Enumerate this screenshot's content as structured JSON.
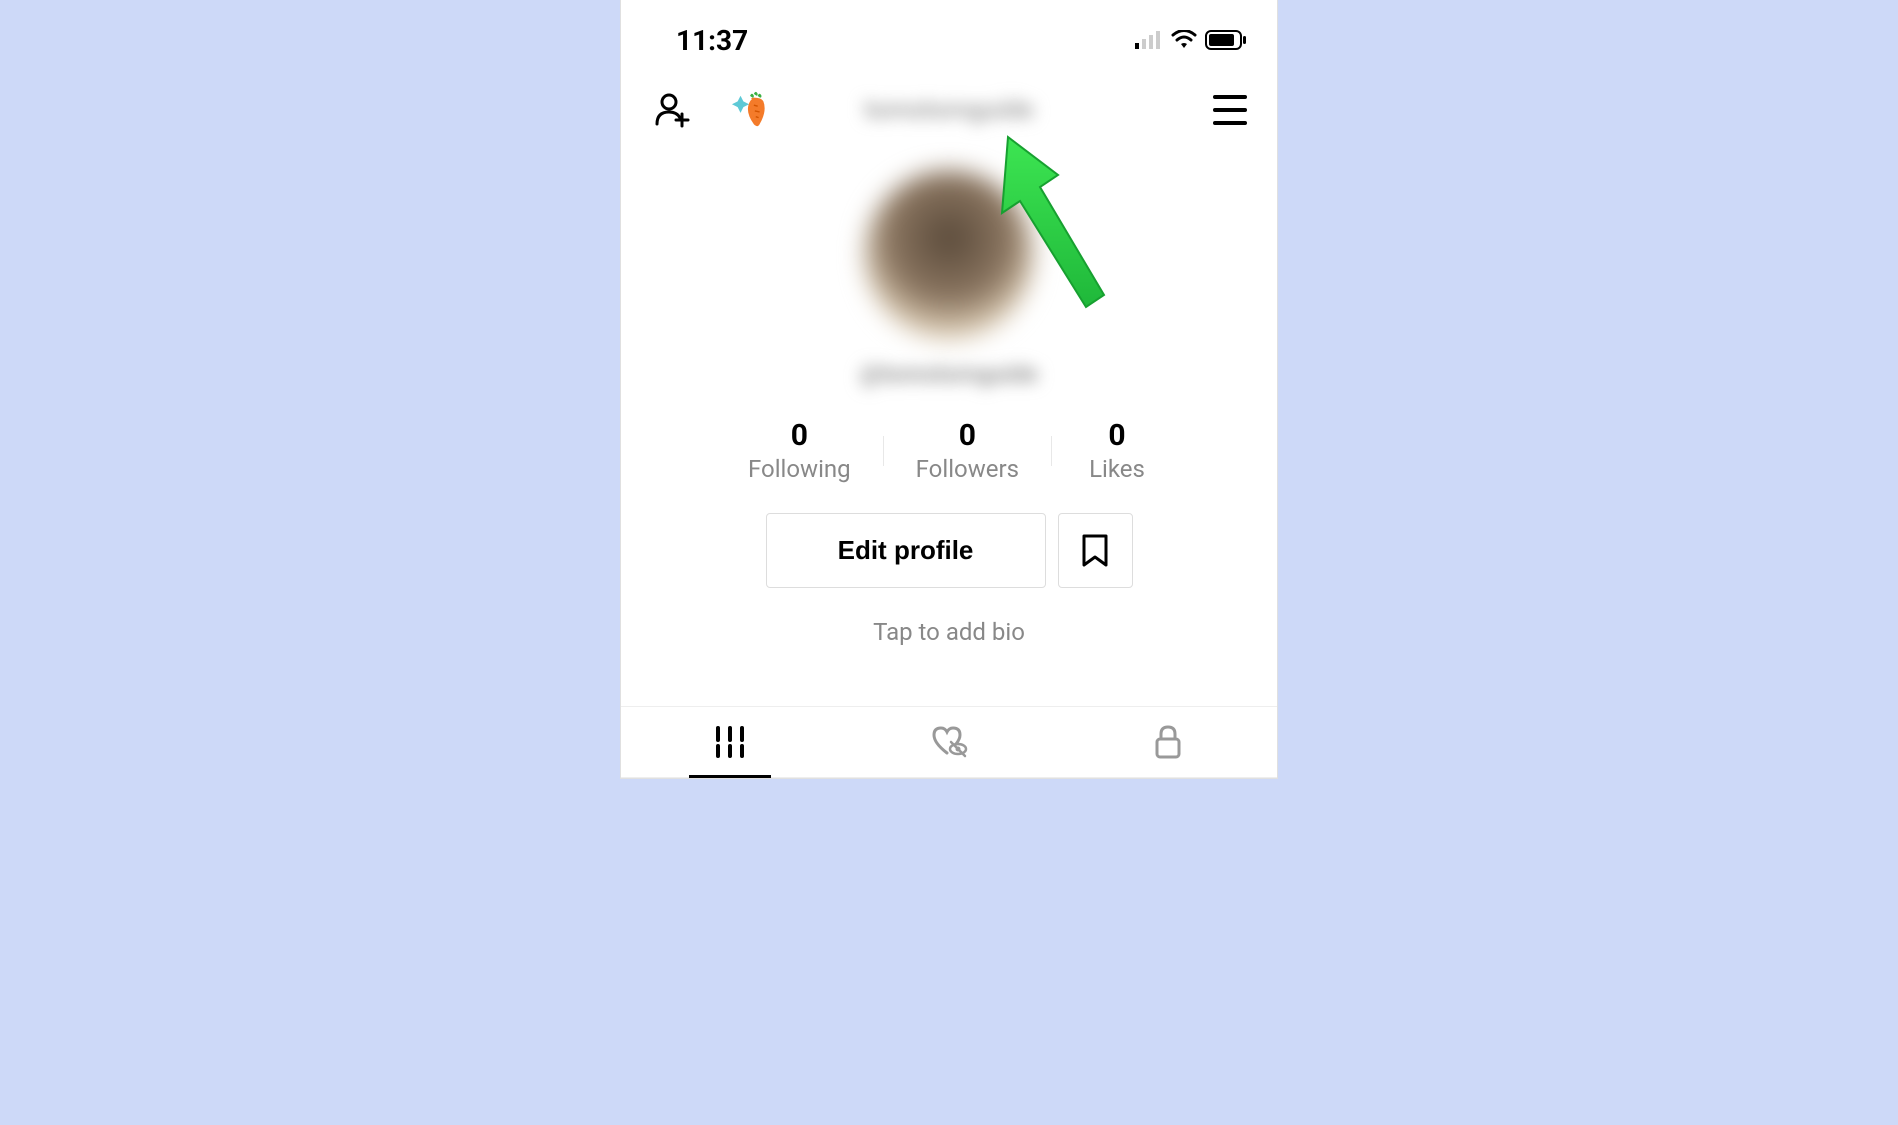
{
  "status_bar": {
    "time": "11:37"
  },
  "header": {
    "username_display": "tomstomguide",
    "carrot_emoji": "🥕"
  },
  "profile": {
    "username_handle": "@tomstomguide",
    "stats": [
      {
        "value": "0",
        "label": "Following"
      },
      {
        "value": "0",
        "label": "Followers"
      },
      {
        "value": "0",
        "label": "Likes"
      }
    ],
    "edit_button_label": "Edit profile",
    "bio_placeholder": "Tap to add bio"
  },
  "tabs": [
    {
      "name": "grid",
      "active": true
    },
    {
      "name": "liked",
      "active": false
    },
    {
      "name": "private",
      "active": false
    }
  ],
  "colors": {
    "background": "#cdd9f8",
    "annotation_arrow": "#2ecc40"
  }
}
